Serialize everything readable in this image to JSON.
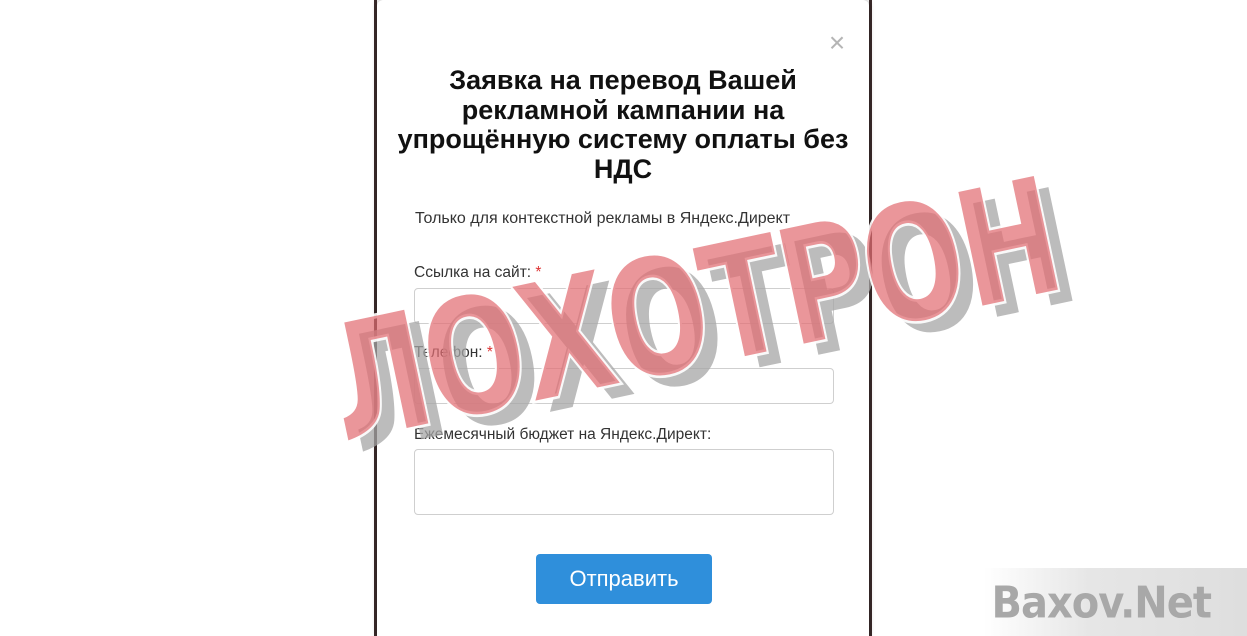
{
  "modal": {
    "close_symbol": "×",
    "title": "Заявка на перевод Вашей рекламной кампании на упрощённую систему оплаты без НДС",
    "subtitle": "Только для контекстной рекламы в Яндекс.Директ",
    "fields": [
      {
        "label": "Ссылка на сайт:",
        "required_mark": "*",
        "value": ""
      },
      {
        "label": "Телефон:",
        "required_mark": "*",
        "value": ""
      },
      {
        "label": "Ежемесячный бюджет на Яндекс.Директ:",
        "value": ""
      }
    ],
    "submit_label": "Отправить"
  },
  "overlay": {
    "stamp_text": "ЛОХОТРОН",
    "watermark_text": "Baxov.Net"
  },
  "colors": {
    "submit_button": "#2f8fdb",
    "required_mark": "#dd3333",
    "stamp": "#e26e73"
  }
}
